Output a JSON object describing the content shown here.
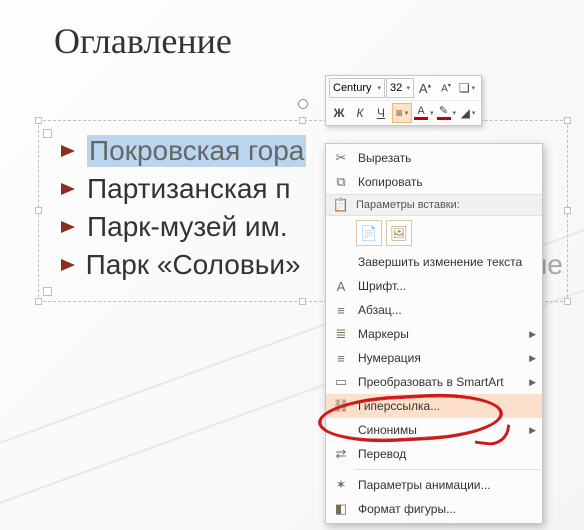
{
  "title": "Оглавление",
  "list": [
    {
      "text": "Покровская гора",
      "selected": true
    },
    {
      "text": "Партизанская п",
      "truncated": true
    },
    {
      "text": "Парк-музей им.",
      "truncated": true
    },
    {
      "text": "Парк «Соловьи»",
      "tail": "сме"
    }
  ],
  "mini_toolbar": {
    "font": "Century",
    "size": "32",
    "grow": "A",
    "shrink": "A",
    "bold": "Ж",
    "italic": "К",
    "underline": "Ч",
    "align": "≡",
    "font_color_sample": "A",
    "bullets": "≡",
    "format_painter": "✎"
  },
  "context_menu": {
    "cut": "Вырезать",
    "copy": "Копировать",
    "paste_header": "Параметры вставки:",
    "finish_edit": "Завершить изменение текста",
    "font": "Шрифт...",
    "paragraph": "Абзац...",
    "bullets": "Маркеры",
    "numbering": "Нумерация",
    "smartart": "Преобразовать в SmartArt",
    "hyperlink": "Гиперссылка...",
    "synonyms": "Синонимы",
    "translate": "Перевод",
    "anim": "Параметры анимации...",
    "format_shape": "Формат фигуры..."
  }
}
